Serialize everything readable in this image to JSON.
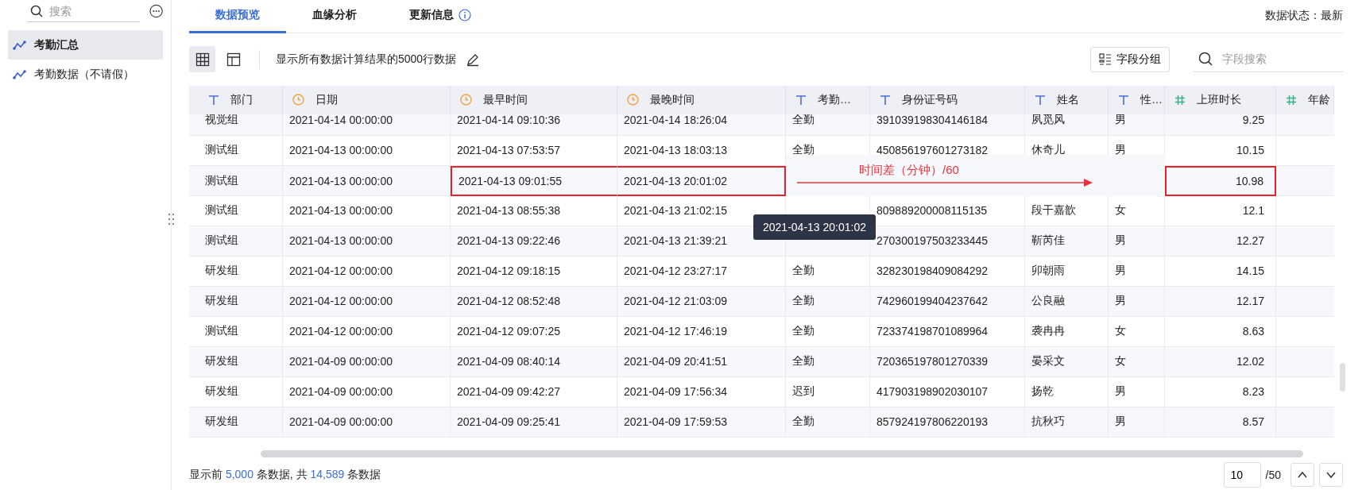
{
  "sidebar": {
    "search": {
      "placeholder": "搜索"
    },
    "items": [
      {
        "label": "考勤汇总",
        "selected": true
      },
      {
        "label": "考勤数据（不请假）",
        "selected": false
      }
    ]
  },
  "tabs": [
    {
      "label": "数据预览",
      "selected": true,
      "kind": "plain"
    },
    {
      "label": "血缘分析",
      "selected": false,
      "kind": "plain"
    },
    {
      "label": "更新信息",
      "selected": false,
      "kind": "info"
    }
  ],
  "data_status": "数据状态：最新",
  "toolbar": {
    "views": [
      {
        "kind": "grid",
        "selected": true
      },
      {
        "kind": "layout",
        "selected": false
      }
    ],
    "description": "显示所有数据计算结果的5000行数据",
    "group_button": "字段分组",
    "field_search": {
      "placeholder": "字段搜索"
    }
  },
  "table": {
    "columns": [
      {
        "label": "部门",
        "kind": "text"
      },
      {
        "label": "日期",
        "kind": "time"
      },
      {
        "label": "最早时间",
        "kind": "time"
      },
      {
        "label": "最晚时间",
        "kind": "time"
      },
      {
        "label": "考勤…",
        "kind": "text"
      },
      {
        "label": "身份证号码",
        "kind": "text"
      },
      {
        "label": "姓名",
        "kind": "text"
      },
      {
        "label": "性…",
        "kind": "text"
      },
      {
        "label": "上班时长",
        "kind": "number"
      },
      {
        "label": "年龄",
        "kind": "number"
      }
    ],
    "rows": [
      {
        "cells": [
          "视觉组",
          "2021-04-14 00:00:00",
          "2021-04-14 09:10:36",
          "2021-04-14 18:26:04",
          "全勤",
          "391039198304146184",
          "夙觅风",
          "男",
          "9.25"
        ]
      },
      {
        "cells": [
          "测试组",
          "2021-04-13 00:00:00",
          "2021-04-13 07:53:57",
          "2021-04-13 18:03:13",
          "全勤",
          "450856197601273182",
          "休奇儿",
          "男",
          "10.15"
        ]
      },
      {
        "cells": [
          "测试组",
          "2021-04-13 00:00:00",
          {
            "text": "2021-04-13 09:01:55",
            "highlighted": true
          },
          {
            "text": "2021-04-13 20:01:02",
            "highlighted": true
          },
          null,
          null,
          null,
          null,
          {
            "text": "10.98",
            "highlighted": true
          }
        ],
        "annotation": {
          "text": "时间差（分钟）/60"
        }
      },
      {
        "cells": [
          "测试组",
          "2021-04-13 00:00:00",
          "2021-04-13 08:55:38",
          "2021-04-13 21:02:15",
          null,
          "809889200008115135",
          "段干嘉歆",
          "女",
          "12.1"
        ]
      },
      {
        "cells": [
          "测试组",
          "2021-04-13 00:00:00",
          "2021-04-13 09:22:46",
          "2021-04-13 21:39:21",
          null,
          "270300197503233445",
          "靳芮佳",
          "男",
          "12.27"
        ]
      },
      {
        "cells": [
          "研发组",
          "2021-04-12 00:00:00",
          "2021-04-12 09:18:15",
          "2021-04-12 23:27:17",
          "全勤",
          "328230198409084292",
          "卯朝雨",
          "男",
          "14.15"
        ]
      },
      {
        "cells": [
          "研发组",
          "2021-04-12 00:00:00",
          "2021-04-12 08:52:48",
          "2021-04-12 21:03:09",
          "全勤",
          "742960199404237642",
          "公良融",
          "男",
          "12.17"
        ]
      },
      {
        "cells": [
          "测试组",
          "2021-04-12 00:00:00",
          "2021-04-12 09:07:25",
          "2021-04-12 17:46:19",
          "全勤",
          "723374198701089964",
          "袭冉冉",
          "女",
          "8.63"
        ]
      },
      {
        "cells": [
          "研发组",
          "2021-04-09 00:00:00",
          "2021-04-09 08:40:14",
          "2021-04-09 20:41:51",
          "全勤",
          "720365197801270339",
          "晏采文",
          "女",
          "12.02"
        ]
      },
      {
        "cells": [
          "研发组",
          "2021-04-09 00:00:00",
          "2021-04-09 09:42:27",
          "2021-04-09 17:56:34",
          "迟到",
          "417903198902030107",
          "扬乾",
          "男",
          "8.23"
        ]
      },
      {
        "cells": [
          "研发组",
          "2021-04-09 00:00:00",
          "2021-04-09 09:25:41",
          "2021-04-09 17:59:53",
          "全勤",
          "857924197806220193",
          "抗秋巧",
          "男",
          "8.57"
        ]
      }
    ],
    "tooltip": "2021-04-13 20:01:02"
  },
  "footer": {
    "parts": [
      {
        "text": "显示前 ",
        "kind": "plain"
      },
      {
        "text": "5,000",
        "kind": "number"
      },
      {
        "text": " 条数据, 共 ",
        "kind": "plain"
      },
      {
        "text": "14,589",
        "kind": "number"
      },
      {
        "text": " 条数据",
        "kind": "plain"
      }
    ]
  },
  "pagination": {
    "page": "10",
    "total": "/50"
  }
}
